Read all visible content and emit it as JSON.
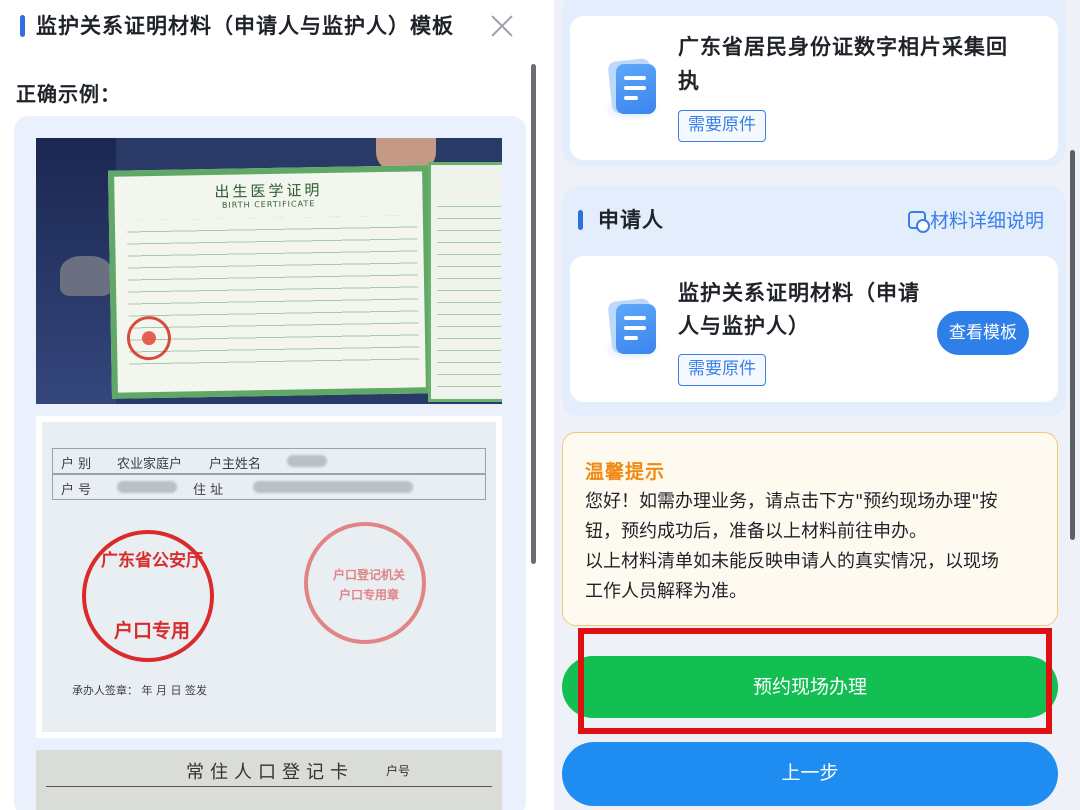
{
  "left_panel": {
    "title": "监护关系证明材料（申请人与监护人）模板",
    "example_label": "正确示例：",
    "birth_certificate": {
      "title": "出生医学证明",
      "subtitle": "BIRTH CERTIFICATE"
    },
    "hukou_page": {
      "cell_hu_bie_label": "户  别",
      "cell_hu_bie_value": "农业家庭户",
      "cell_huzhu_label": "户主姓名",
      "cell_huhao_label": "户  号",
      "cell_address_label": "住  址",
      "stamp_left_line1": "广东省公安厅",
      "stamp_left_line2": "户口专用",
      "stamp_right_line1": "户口登记机关",
      "stamp_right_line2": "户口专用章",
      "footer_text": "承办人签章：            年    月    日    签发"
    },
    "registration_card": {
      "title": "常住人口登记卡",
      "number_label": "户号"
    }
  },
  "right_panel": {
    "top_card": {
      "title_line1": "广东省居民身份证数字相片采集回",
      "title_line2": "执",
      "tag": "需要原件"
    },
    "applicant_section": {
      "title": "申请人",
      "detail_link": "材料详细说明",
      "card": {
        "title_line1": "监护关系证明材料（申请",
        "title_line2": "人与监护人）",
        "tag": "需要原件",
        "view_template_button": "查看模板"
      }
    },
    "tips": {
      "title": "温馨提示",
      "line1": "您好！如需办理业务，请点击下方\"预约现场办理\"按",
      "line2": "钮，预约成功后，准备以上材料前往申办。",
      "line3": "以上材料清单如未能反映申请人的真实情况，以现场",
      "line4": "工作人员解释为准。"
    },
    "primary_button": "预约现场办理",
    "secondary_button": "上一步"
  },
  "colors": {
    "accent_blue": "#2f6fe0",
    "button_green": "#13be52",
    "button_blue": "#1e8cf0",
    "highlight_red": "#e01010",
    "tips_orange": "#f08a12"
  },
  "icons": [
    "close-icon",
    "document-icon",
    "detail-icon"
  ]
}
